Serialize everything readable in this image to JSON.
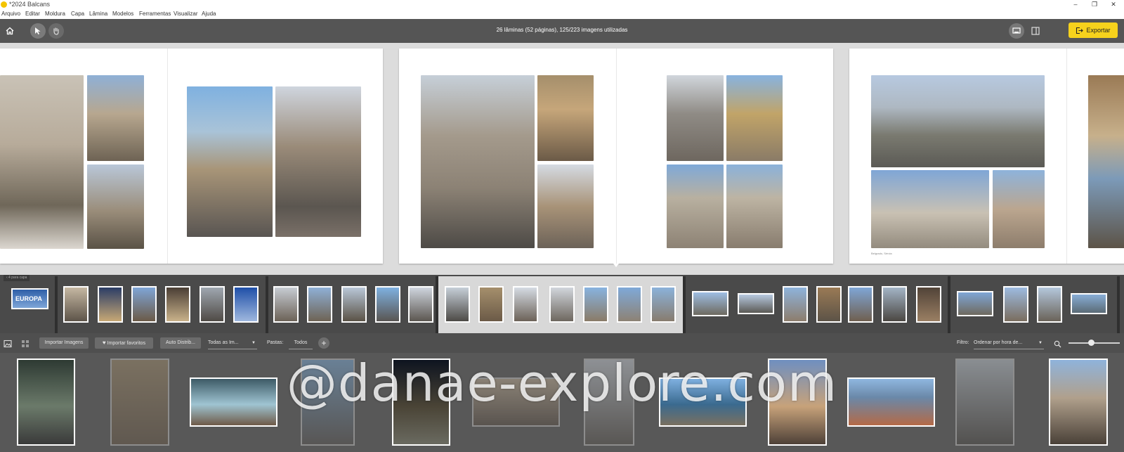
{
  "window": {
    "title": "*2024 Balcans",
    "minimize": "–",
    "maximize": "❐",
    "close": "✕"
  },
  "menu": [
    "Arquivo",
    "Editar",
    "Moldura",
    "Capa",
    "Lâmina",
    "Modelos",
    "Ferramentas",
    "Visualizar",
    "Ajuda"
  ],
  "toolbar": {
    "status": "26 lâminas (52 páginas), 125/223 imagens utilizadas",
    "export_label": "Exportar",
    "icons": [
      "home-icon",
      "pointer-icon",
      "hand-icon",
      "single-view-icon",
      "split-view-icon",
      "export-icon"
    ]
  },
  "canvas": {
    "caption": "Belgrado, Sérvia"
  },
  "filmstrip": {
    "prev_label": "‹ 4 para capa",
    "cover_text": "EUROPA"
  },
  "library_bar": {
    "import_images": "Importar Imagens",
    "import_favorites": "Importar favoritos",
    "auto_distribute": "Auto Distrib...",
    "all_images": "Todas as Im...",
    "folders_label": "Pastas:",
    "folder_all": "Todos",
    "add_folder": "+",
    "filter_label": "Filtro:",
    "sort_value": "Ordenar por hora de...",
    "zoom_level": 0.45
  },
  "watermark": "@danae-explore.com",
  "colors": {
    "accent": "#f6d21c",
    "toolbar": "#555555",
    "filmstrip": "#4a4a4a",
    "library": "#585858"
  }
}
